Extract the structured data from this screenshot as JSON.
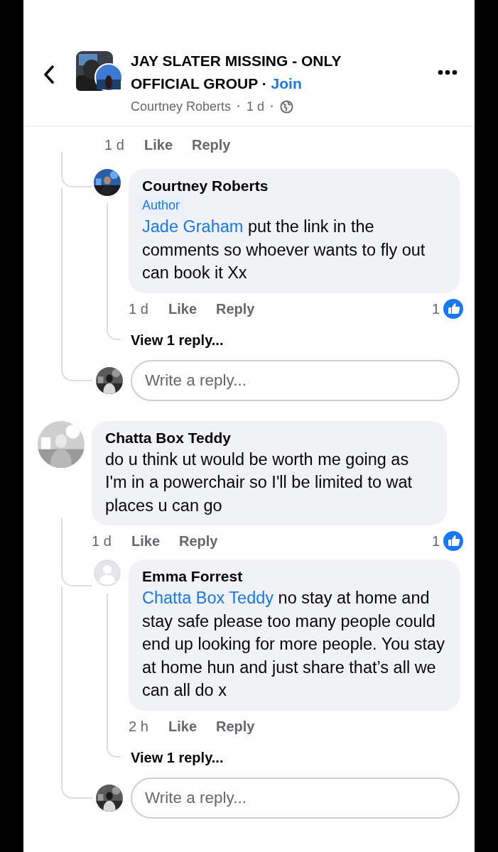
{
  "header": {
    "title": "JAY SLATER MISSING - ONLY OFFICIAL GROUP",
    "title_separator": "·",
    "join": "Join",
    "meta": [
      {
        "kind": "author",
        "text": "Courtney Roberts"
      },
      {
        "kind": "separator",
        "text": "·"
      },
      {
        "kind": "time",
        "text": "1 d"
      },
      {
        "kind": "separator",
        "text": "·"
      }
    ]
  },
  "threads": [
    {
      "parent_actions": {
        "time": "1 d",
        "like": "Like",
        "reply": "Reply"
      },
      "replies": [
        {
          "name": "Courtney Roberts",
          "generic_avatar": false,
          "badge": "Author",
          "mention": "Jade Graham",
          "text": "put the link in the comments so whoever wants to fly out can book it Xx",
          "time": "1 d",
          "like": "Like",
          "reply": "Reply",
          "reactions": "1",
          "view_replies": "View 1 reply..."
        }
      ],
      "reply_box": {
        "placeholder": "Write a reply..."
      }
    },
    {
      "parent": {
        "name": "Chatta Box Teddy",
        "generic_avatar": false,
        "text": "do u think ut would be worth me going as I'm in a powerchair so I'll be limited to wat places u can go",
        "time": "1 d",
        "like": "Like",
        "reply": "Reply",
        "reactions": "1"
      },
      "replies": [
        {
          "name": "Emma Forrest",
          "generic_avatar": true,
          "mention": "Chatta Box Teddy",
          "text": "no stay at home and stay safe please too many people could end up looking for more people. You stay at home hun and just share that’s all we can all do x",
          "time": "2 h",
          "like": "Like",
          "reply": "Reply",
          "view_replies": "View 1 reply..."
        }
      ],
      "reply_box": {
        "placeholder": "Write a reply..."
      }
    }
  ]
}
